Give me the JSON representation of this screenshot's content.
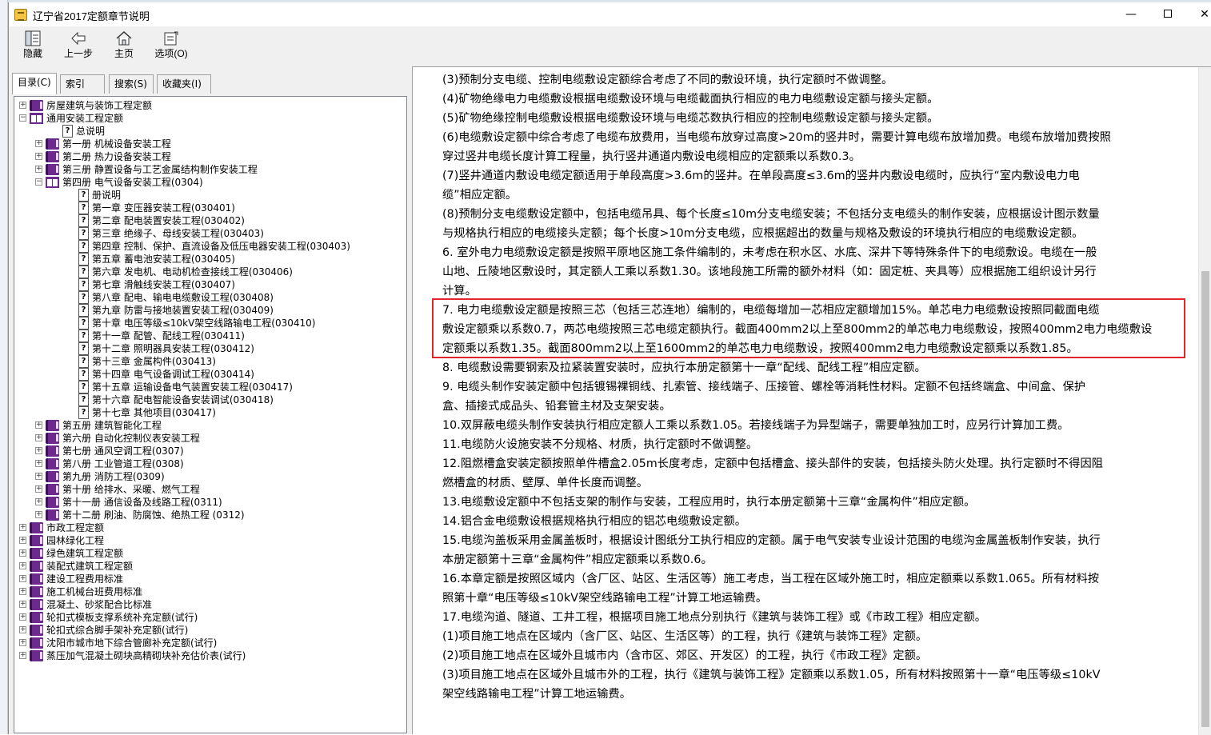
{
  "window": {
    "title": "辽宁省2017定额章节说明",
    "min_label": "—",
    "close_label": "✕"
  },
  "toolbar": {
    "hide_label": "隐藏",
    "back_label": "上一步",
    "home_label": "主页",
    "options_label": "选项(O)"
  },
  "tabs": [
    "目录(C)",
    "索引(N)",
    "搜索(S)",
    "收藏夹(I)"
  ],
  "tree": [
    {
      "text": "房屋建筑与装饰工程定额",
      "level": 0,
      "type": "closed",
      "exp": "+"
    },
    {
      "text": "通用安装工程定额",
      "level": 0,
      "type": "open",
      "exp": "−"
    },
    {
      "text": "总说明",
      "level": 1,
      "type": "doc"
    },
    {
      "text": "第一册 机械设备安装工程",
      "level": 1,
      "type": "closed",
      "exp": "+"
    },
    {
      "text": "第二册 热力设备安装工程",
      "level": 1,
      "type": "closed",
      "exp": "+"
    },
    {
      "text": "第三册 静置设备与工艺金属结构制作安装工程",
      "level": 1,
      "type": "closed",
      "exp": "+"
    },
    {
      "text": "第四册 电气设备安装工程(0304)",
      "level": 1,
      "type": "open",
      "exp": "−"
    },
    {
      "text": "册说明",
      "level": 2,
      "type": "doc"
    },
    {
      "text": "第一章 变压器安装工程(030401)",
      "level": 2,
      "type": "doc"
    },
    {
      "text": "第二章 配电装置安装工程(030402)",
      "level": 2,
      "type": "doc"
    },
    {
      "text": "第三章 绝缘子、母线安装工程(030403)",
      "level": 2,
      "type": "doc"
    },
    {
      "text": "第四章 控制、保护、直流设备及低压电器安装工程(030403)",
      "level": 2,
      "type": "doc"
    },
    {
      "text": "第五章 蓄电池安装工程(030405)",
      "level": 2,
      "type": "doc"
    },
    {
      "text": "第六章 发电机、电动机检查接线工程(030406)",
      "level": 2,
      "type": "doc"
    },
    {
      "text": "第七章 滑触线安装工程(030407)",
      "level": 2,
      "type": "doc"
    },
    {
      "text": "第八章 配电、输电电缆敷设工程(030408)",
      "level": 2,
      "type": "doc"
    },
    {
      "text": "第九章 防雷与接地装置安装工程(030409)",
      "level": 2,
      "type": "doc"
    },
    {
      "text": "第十章 电压等级≤10kV架空线路输电工程(030410)",
      "level": 2,
      "type": "doc"
    },
    {
      "text": "第十一章 配管、配线工程(030411)",
      "level": 2,
      "type": "doc"
    },
    {
      "text": "第十二章 照明器具安装工程(030412)",
      "level": 2,
      "type": "doc"
    },
    {
      "text": "第十三章 金属构件(030413)",
      "level": 2,
      "type": "doc"
    },
    {
      "text": "第十四章 电气设备调试工程(030414)",
      "level": 2,
      "type": "doc"
    },
    {
      "text": "第十五章 运输设备电气装置安装工程(030417)",
      "level": 2,
      "type": "doc"
    },
    {
      "text": "第十六章 配电智能设备安装调试(030418)",
      "level": 2,
      "type": "doc"
    },
    {
      "text": "第十七章 其他项目(030417)",
      "level": 2,
      "type": "doc"
    },
    {
      "text": "第五册 建筑智能化工程",
      "level": 1,
      "type": "closed",
      "exp": "+"
    },
    {
      "text": "第六册 自动化控制仪表安装工程",
      "level": 1,
      "type": "closed",
      "exp": "+"
    },
    {
      "text": "第七册 通风空调工程(0307)",
      "level": 1,
      "type": "closed",
      "exp": "+"
    },
    {
      "text": "第八册 工业管道工程(0308)",
      "level": 1,
      "type": "closed",
      "exp": "+"
    },
    {
      "text": "第九册 消防工程(0309)",
      "level": 1,
      "type": "closed",
      "exp": "+"
    },
    {
      "text": "第十册 给排水、采暖、燃气工程",
      "level": 1,
      "type": "closed",
      "exp": "+"
    },
    {
      "text": "第十一册 通信设备及线路工程(0311)",
      "level": 1,
      "type": "closed",
      "exp": "+"
    },
    {
      "text": "第十二册  刷油、防腐蚀、绝热工程  (0312)",
      "level": 1,
      "type": "closed",
      "exp": "+"
    },
    {
      "text": "市政工程定额",
      "level": 0,
      "type": "closed",
      "exp": "+"
    },
    {
      "text": "园林绿化工程",
      "level": 0,
      "type": "closed",
      "exp": "+"
    },
    {
      "text": "绿色建筑工程定额",
      "level": 0,
      "type": "closed",
      "exp": "+"
    },
    {
      "text": "装配式建筑工程定额",
      "level": 0,
      "type": "closed",
      "exp": "+"
    },
    {
      "text": "建设工程费用标准",
      "level": 0,
      "type": "closed",
      "exp": "+"
    },
    {
      "text": "施工机械台班费用标准",
      "level": 0,
      "type": "closed",
      "exp": "+"
    },
    {
      "text": "混凝土、砂浆配合比标准",
      "level": 0,
      "type": "closed",
      "exp": "+"
    },
    {
      "text": "轮扣式模板支撑系统补充定额(试行)",
      "level": 0,
      "type": "closed",
      "exp": "+"
    },
    {
      "text": "轮扣式综合脚手架补充定额(试行)",
      "level": 0,
      "type": "closed",
      "exp": "+"
    },
    {
      "text": "沈阳市城市地下综合管廊补充定额(试行)",
      "level": 0,
      "type": "closed",
      "exp": "+"
    },
    {
      "text": "蒸压加气混凝土砌块高精砌块补充估价表(试行)",
      "level": 0,
      "type": "closed",
      "exp": "+"
    }
  ],
  "content": [
    "(3)预制分支电缆、控制电缆敷设定额综合考虑了不同的敷设环境，执行定额时不做调整。",
    "(4)矿物绝缘电力电缆敷设根据电缆敷设环境与电缆截面执行相应的电力电缆敷设定额与接头定额。",
    "(5)矿物绝缘控制电缆敷设根据电缆敷设环境与电缆芯数执行相应的控制电缆敷设定额与接头定额。",
    "(6)电缆敷设定额中综合考虑了电缆布放费用，当电缆布放穿过高度>20m的竖井时，需要计算电缆布放增加费。电缆布放增加费按照",
    "穿过竖井电缆长度计算工程量，执行竖井通道内敷设电缆相应的定额乘以系数0.3。",
    "(7)竖井通道内敷设电缆定额适用于单段高度>3.6m的竖井。在单段高度≤3.6m的竖井内敷设电缆时，应执行“室内敷设电力电",
    "缆”相应定额。",
    "(8)预制分支电缆敷设定额中，包括电缆吊具、每个长度≤10m分支电缆安装；不包括分支电缆头的制作安装，应根据设计图示数量",
    "与规格执行相应的电缆接头定额；每个长度>10m分支电缆，应根据超出的数量与规格及敷设的环境执行相应的电缆敷设定额。",
    "6. 室外电力电缆敷设定额是按照平原地区施工条件编制的，未考虑在积水区、水底、深井下等特殊条件下的电缆敷设。电缆在一般",
    "山地、丘陵地区敷设时，其定额人工乘以系数1.30。该地段施工所需的额外材料（如：固定桩、夹具等）应根据施工组织设计另行",
    "计算。",
    "7. 电力电缆敷设定额是按照三芯（包括三芯连地）编制的，电缆每增加一芯相应定额增加15%。单芯电力电缆敷设按照同截面电缆",
    "敷设定额乘以系数0.7，两芯电缆按照三芯电缆定额执行。截面400mm2以上至800mm2的单芯电力电缆敷设，按照400mm2电力电缆敷设",
    "定额乘以系数1.35。截面800mm2以上至1600mm2的单芯电力电缆敷设，按照400mm2电力电缆敷设定额乘以系数1.85。",
    "8. 电缆敷设需要钢索及拉紧装置安装时，应执行本册定额第十一章“配线、配线工程”相应定额。",
    "9. 电缆头制作安装定额中包括镀锡裸铜线、扎索管、接线端子、压接管、螺栓等消耗性材料。定额不包括终端盒、中间盒、保护",
    "盒、插接式成品头、铅套管主材及支架安装。",
    "10.双屏蔽电缆头制作安装执行相应定额人工乘以系数1.05。若接线端子为异型端子，需要单独加工时，应另行计算加工费。",
    "11.电缆防火设施安装不分规格、材质，执行定额时不做调整。",
    "12.阻燃槽盒安装定额按照单件槽盒2.05m长度考虑，定额中包括槽盒、接头部件的安装，包括接头防火处理。执行定额时不得因阻",
    "燃槽盒的材质、壁厚、单件长度而调整。",
    "13.电缆敷设定额中不包括支架的制作与安装，工程应用时，执行本册定额第十三章“金属构件”相应定额。",
    "14.铝合金电缆敷设根据规格执行相应的铝芯电缆敷设定额。",
    "15.电缆沟盖板采用金属盖板时，根据设计图纸分工执行相应的定额。属于电气安装专业设计范围的电缆沟金属盖板制作安装，执行",
    "本册定额第十三章“金属构件”相应定额乘以系数0.6。",
    "16.本章定额是按照区域内（含厂区、站区、生活区等）施工考虑，当工程在区域外施工时，相应定额乘以系数1.065。所有材料按",
    "照第十章“电压等级≤10kV架空线路输电工程”计算工地运输费。",
    "17.电缆沟道、隧道、工井工程，根据项目施工地点分别执行《建筑与装饰工程》或《市政工程》相应定额。",
    "(1)项目施工地点在区域内（含厂区、站区、生活区等）的工程，执行《建筑与装饰工程》定额。",
    "(2)项目施工地点在区域外且城市内（含市区、郊区、开发区）的工程，执行《市政工程》定额。",
    "(3)项目施工地点在区域外且城市外的工程，执行《建筑与装饰工程》定额乘以系数1.05，所有材料按照第十一章“电压等级≤10kV",
    "架空线路输电工程”计算工地运输费。"
  ],
  "colors": {
    "highlight_border": "#e0252b",
    "book_purple": "#6c2b8c"
  }
}
